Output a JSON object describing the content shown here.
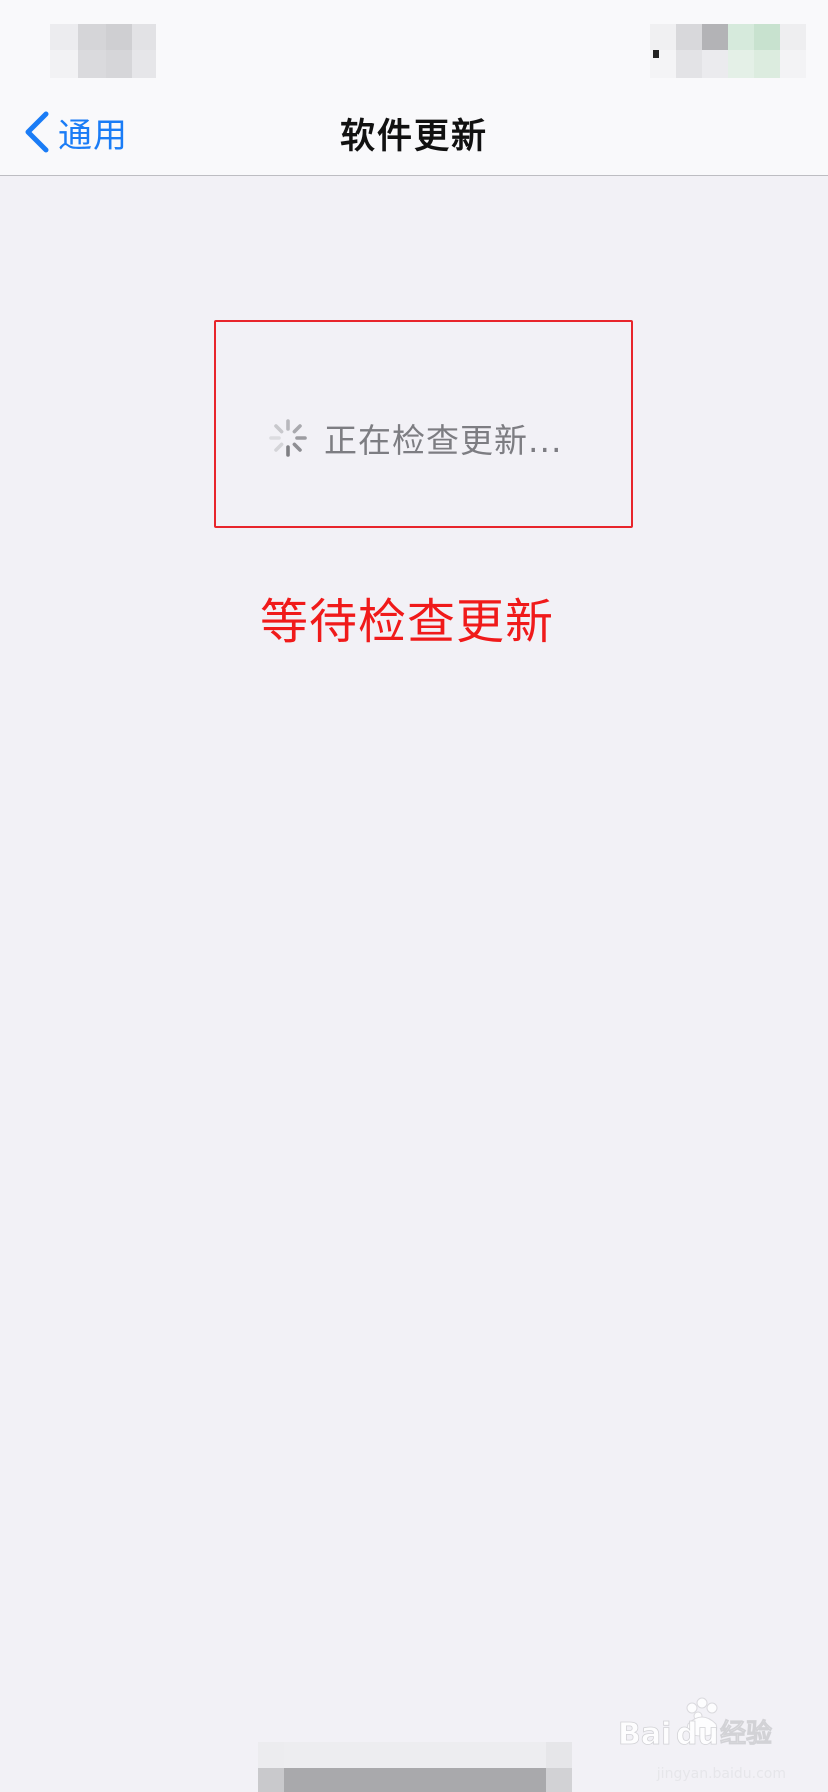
{
  "nav": {
    "back_label": "通用",
    "title": "软件更新"
  },
  "status": {
    "checking_text": "正在检查更新...",
    "annotation": "等待检查更新"
  },
  "watermark": {
    "logo_text": "Baidu经验",
    "url": "jingyan.baidu.com"
  },
  "colors": {
    "accent": "#1a7cf6",
    "annotation_red": "#f01a1a",
    "background": "#f2f1f6"
  }
}
